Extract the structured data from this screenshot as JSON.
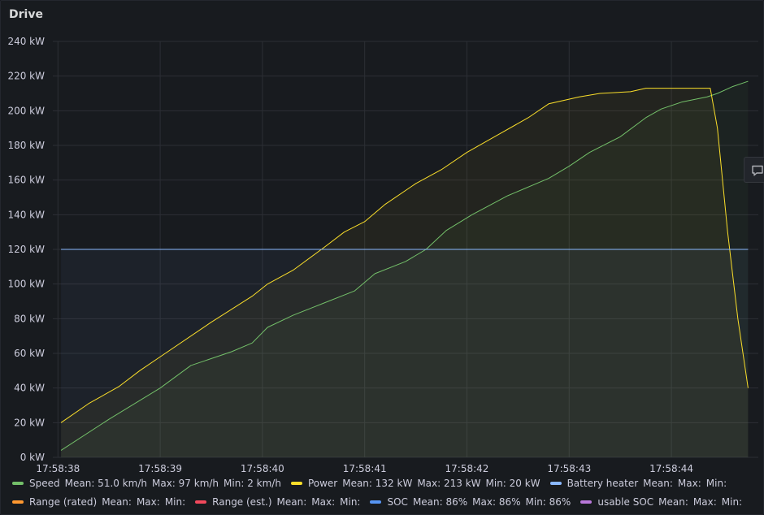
{
  "panel": {
    "title": "Drive"
  },
  "chart_data": {
    "type": "line",
    "title": "Drive",
    "ylim": [
      0,
      240
    ],
    "y_ticks": [
      0,
      20,
      40,
      60,
      80,
      100,
      120,
      140,
      160,
      180,
      200,
      220,
      240
    ],
    "y_unit": " kW",
    "x_ticks": [
      "17:58:38",
      "17:58:39",
      "17:58:40",
      "17:58:41",
      "17:58:42",
      "17:58:43",
      "17:58:44"
    ],
    "xlim_seconds_from_first_tick": [
      -0.05,
      6.85
    ],
    "grid": true,
    "series": [
      {
        "name": "Speed",
        "color": "#73bf69",
        "fill": true,
        "points": [
          [
            0.03,
            4
          ],
          [
            0.5,
            22
          ],
          [
            1.0,
            40
          ],
          [
            1.3,
            53
          ],
          [
            1.7,
            61
          ],
          [
            1.9,
            66
          ],
          [
            2.05,
            75
          ],
          [
            2.3,
            82
          ],
          [
            2.6,
            89
          ],
          [
            2.9,
            96
          ],
          [
            3.1,
            106
          ],
          [
            3.4,
            113
          ],
          [
            3.6,
            120
          ],
          [
            3.8,
            131
          ],
          [
            4.05,
            140
          ],
          [
            4.4,
            151
          ],
          [
            4.8,
            161
          ],
          [
            5.0,
            168
          ],
          [
            5.2,
            176
          ],
          [
            5.5,
            185
          ],
          [
            5.75,
            196
          ],
          [
            5.9,
            201
          ],
          [
            6.1,
            205
          ],
          [
            6.35,
            208
          ],
          [
            6.45,
            210
          ],
          [
            6.6,
            214
          ],
          [
            6.75,
            217
          ]
        ]
      },
      {
        "name": "Power",
        "color": "#fade2a",
        "fill": true,
        "points": [
          [
            0.03,
            20
          ],
          [
            0.3,
            31
          ],
          [
            0.6,
            41
          ],
          [
            0.8,
            50
          ],
          [
            1.0,
            58
          ],
          [
            1.5,
            78
          ],
          [
            1.9,
            93
          ],
          [
            2.05,
            100
          ],
          [
            2.3,
            108
          ],
          [
            2.6,
            121
          ],
          [
            2.8,
            130
          ],
          [
            3.0,
            136
          ],
          [
            3.2,
            146
          ],
          [
            3.5,
            158
          ],
          [
            3.75,
            166
          ],
          [
            4.0,
            176
          ],
          [
            4.3,
            186
          ],
          [
            4.6,
            196
          ],
          [
            4.8,
            204
          ],
          [
            5.1,
            208
          ],
          [
            5.3,
            210
          ],
          [
            5.6,
            211
          ],
          [
            5.75,
            213
          ],
          [
            6.1,
            213
          ],
          [
            6.38,
            213
          ],
          [
            6.45,
            190
          ],
          [
            6.55,
            130
          ],
          [
            6.65,
            80
          ],
          [
            6.75,
            40
          ]
        ]
      },
      {
        "name": "Battery heater",
        "color": "#8ab8ff",
        "fill": true,
        "points": [
          [
            0.03,
            120
          ],
          [
            6.75,
            120
          ]
        ]
      }
    ]
  },
  "legend": {
    "rows": [
      [
        {
          "name": "Speed",
          "color": "#73bf69",
          "stats": [
            "Mean: 51.0 km/h",
            "Max: 97 km/h",
            "Min: 2 km/h"
          ]
        },
        {
          "name": "Power",
          "color": "#fade2a",
          "stats": [
            "Mean: 132 kW",
            "Max: 213 kW",
            "Min: 20 kW"
          ]
        },
        {
          "name": "Battery heater",
          "color": "#8ab8ff",
          "stats": [
            "Mean:",
            "Max:",
            "Min:"
          ]
        }
      ],
      [
        {
          "name": "Range (rated)",
          "color": "#ff9830",
          "stats": [
            "Mean:",
            "Max:",
            "Min:"
          ]
        },
        {
          "name": "Range (est.)",
          "color": "#f2495c",
          "stats": [
            "Mean:",
            "Max:",
            "Min:"
          ]
        },
        {
          "name": "SOC",
          "color": "#5794f2",
          "stats": [
            "Mean: 86%",
            "Max: 86%",
            "Min: 86%"
          ]
        },
        {
          "name": "usable SOC",
          "color": "#b877d9",
          "stats": [
            "Mean:",
            "Max:",
            "Min:"
          ]
        }
      ]
    ]
  },
  "side_button": {
    "icon": "comment-icon"
  }
}
